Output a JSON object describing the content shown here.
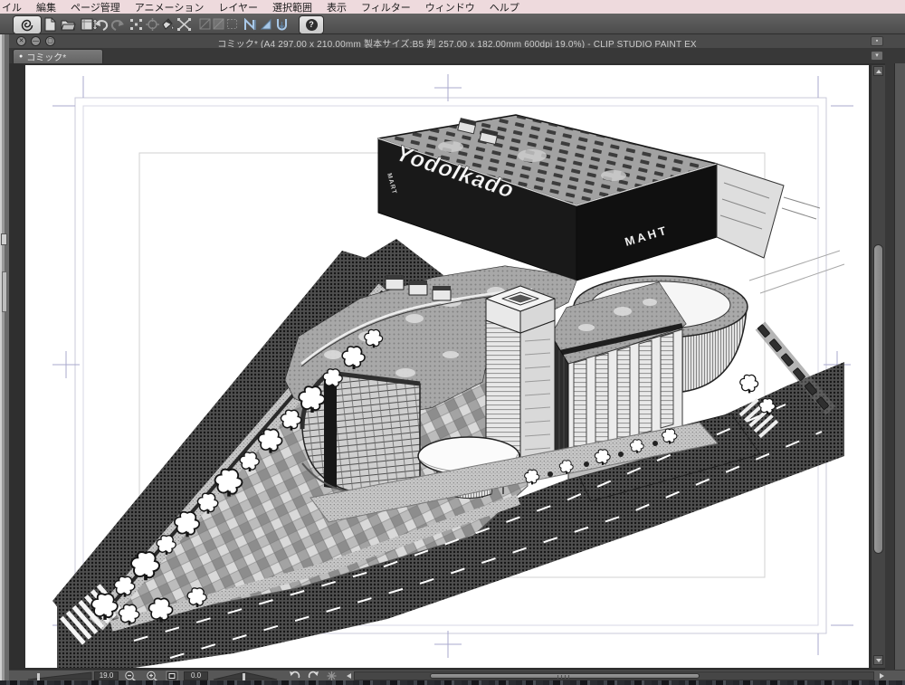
{
  "menu_bar": {
    "items": [
      "イル",
      "編集",
      "ページ管理",
      "アニメーション",
      "レイヤー",
      "選択範囲",
      "表示",
      "フィルター",
      "ウィンドウ",
      "ヘルプ"
    ]
  },
  "toolbar": {
    "icons": [
      "clip-studio-logo",
      "new-file",
      "open-file",
      "save-page",
      "undo",
      "redo",
      "scale-rotate",
      "move",
      "fill-ink",
      "free-transform",
      "snap-disabled-1",
      "snap-disabled-2",
      "snap-disabled-3",
      "snap-to-ruler",
      "snap-to-special-ruler",
      "snap-to-grid",
      "help"
    ],
    "help_glyph": "?"
  },
  "window": {
    "title": "コミック* (A4 297.00 x 210.00mm 製本サイズ:B5 判 257.00 x 182.00mm 600dpi 19.0%)  - CLIP STUDIO PAINT EX",
    "close_glyph": "✕",
    "minimize_glyph": "—",
    "zoom_glyph": "▢"
  },
  "tab": {
    "label": "コミック*",
    "modified_indicator": "●"
  },
  "canvas": {
    "signage_main": "YodoIkado",
    "signage_side": "MAHT",
    "signage_small": "MART"
  },
  "status_bar": {
    "zoom_value": "19.0",
    "rotation_value": "0.0",
    "icons": [
      "zoom-slider",
      "zoom-out",
      "zoom-in",
      "fit-to-screen",
      "rotation-slider",
      "rotate-ccw",
      "rotate-cw",
      "reset-rotation",
      "h-scrollbar"
    ]
  },
  "colors": {
    "menu_bar_bg": "#eedadd",
    "chrome_dark": "#4a4a4a",
    "canvas_bg": "#ffffff",
    "snap_icon_accent": "#a9c9e9",
    "guide_line": "#b9b9d6"
  }
}
